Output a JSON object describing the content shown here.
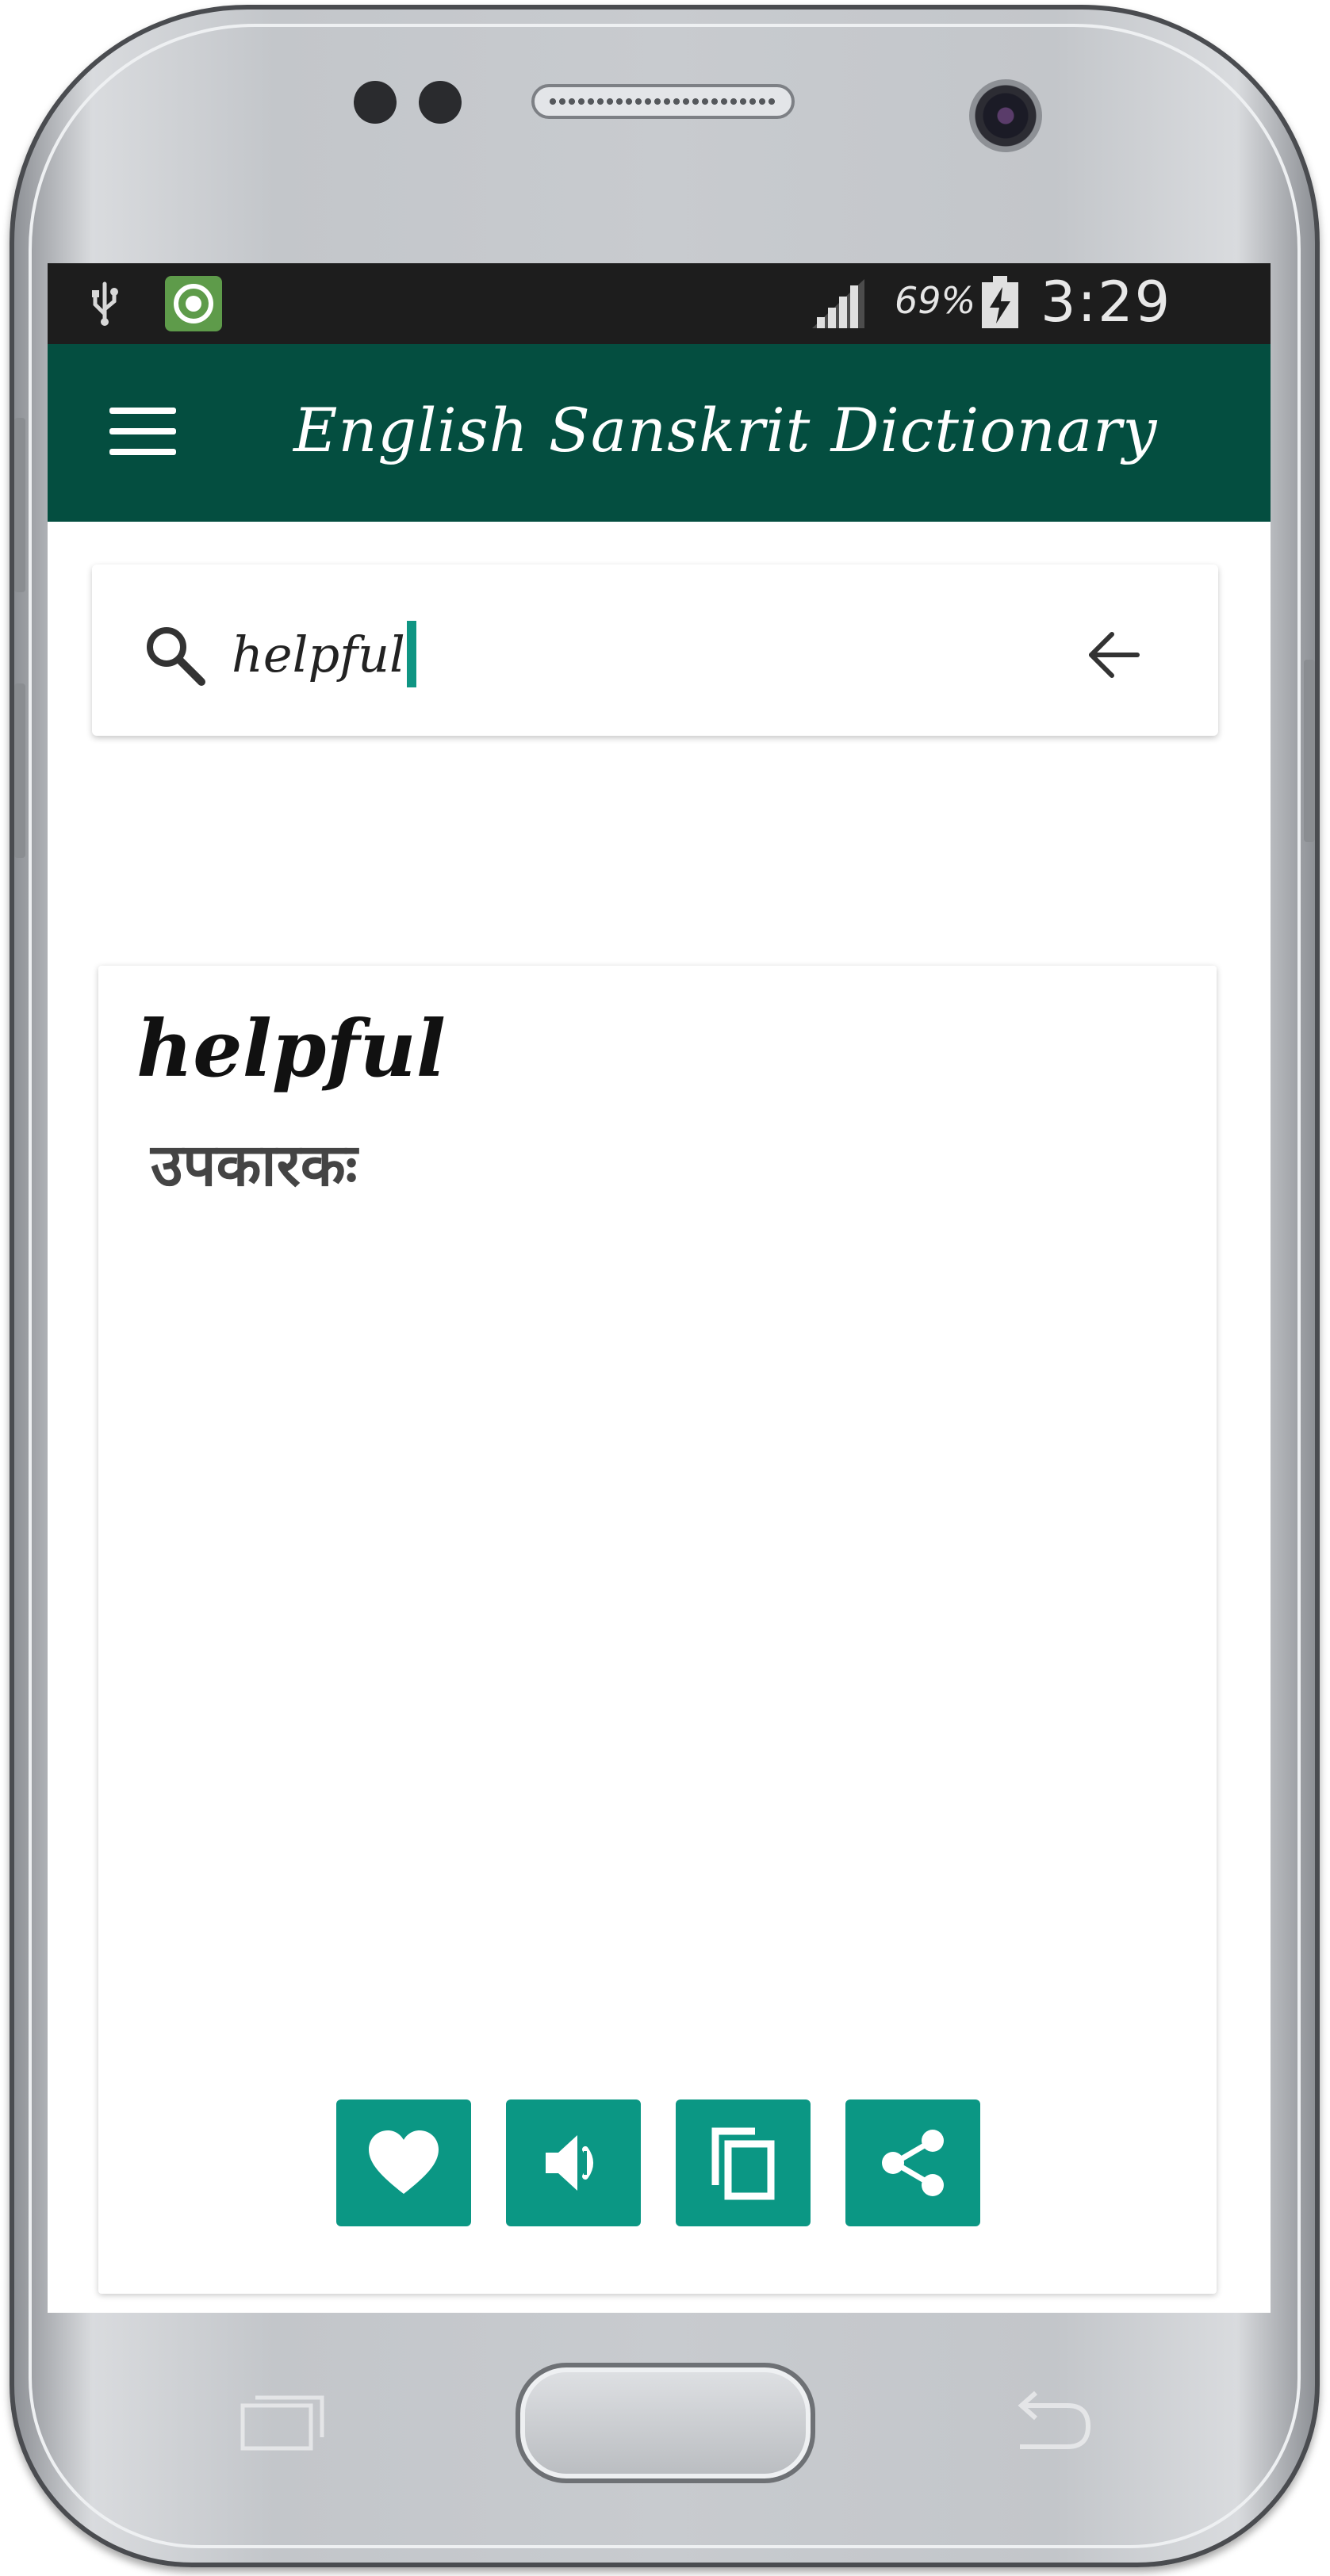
{
  "status_bar": {
    "battery_percent": "69%",
    "time": "3:29 PM",
    "icons": [
      "usb-icon",
      "app-notification-icon",
      "signal-icon",
      "battery-charging-icon"
    ]
  },
  "app_bar": {
    "title": "English Sanskrit Dictionary",
    "menu_icon": "hamburger-menu-icon",
    "background_color": "#044e40"
  },
  "search": {
    "value": "helpful",
    "search_icon": "search-icon",
    "back_icon": "arrow-left-icon"
  },
  "result": {
    "word": "helpful",
    "meaning": "उपकारकः"
  },
  "actions": [
    {
      "name": "favorite",
      "icon": "heart-icon"
    },
    {
      "name": "speak",
      "icon": "speaker-icon"
    },
    {
      "name": "copy",
      "icon": "copy-icon"
    },
    {
      "name": "share",
      "icon": "share-icon"
    }
  ],
  "accent_color": "#0b9784"
}
